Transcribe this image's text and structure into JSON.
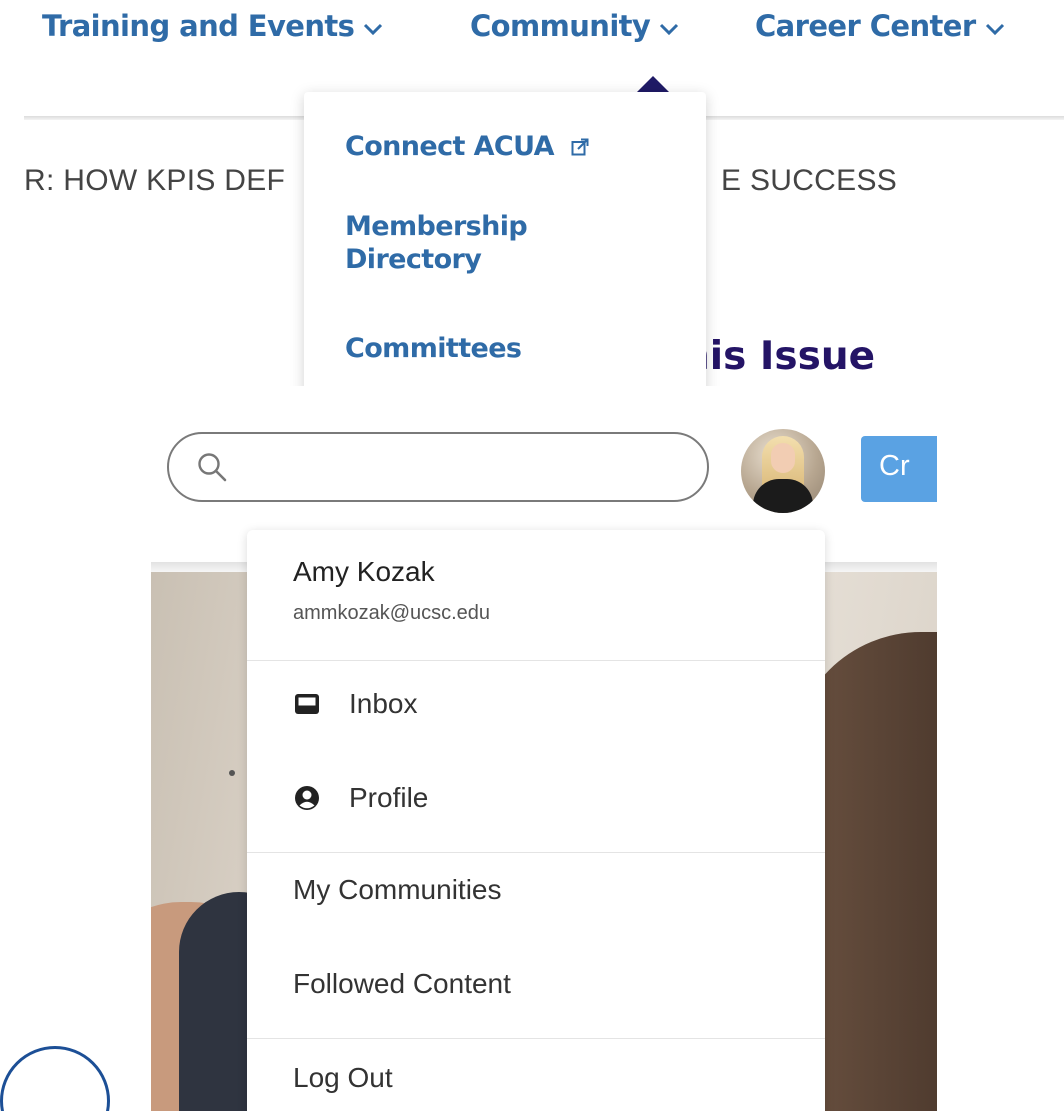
{
  "nav": {
    "items": [
      {
        "label": "Training and Events"
      },
      {
        "label": "Community"
      },
      {
        "label": "Career Center"
      }
    ]
  },
  "community_menu": {
    "items": [
      {
        "label": "Connect ACUA"
      },
      {
        "label": "Membership Directory"
      },
      {
        "label": "Committees"
      }
    ]
  },
  "news": {
    "headline_part1": "R: HOW KPIS DEF",
    "headline_part2": "E SUCCESS"
  },
  "issue_heading": "his Issue",
  "search": {
    "value": "",
    "placeholder": ""
  },
  "create_button": {
    "label": "Cr"
  },
  "user_menu": {
    "name": "Amy Kozak",
    "email": "ammkozak@ucsc.edu",
    "items": [
      {
        "label": "Inbox",
        "icon": "inbox-icon"
      },
      {
        "label": "Profile",
        "icon": "user-circle-icon"
      },
      {
        "label": "My Communities"
      },
      {
        "label": "Followed Content"
      },
      {
        "label": "Log Out"
      }
    ]
  },
  "colors": {
    "nav_link": "#2f6ba7",
    "caret": "#1f1a66",
    "issue_heading": "#241466",
    "create_button": "#5aa2e3"
  }
}
